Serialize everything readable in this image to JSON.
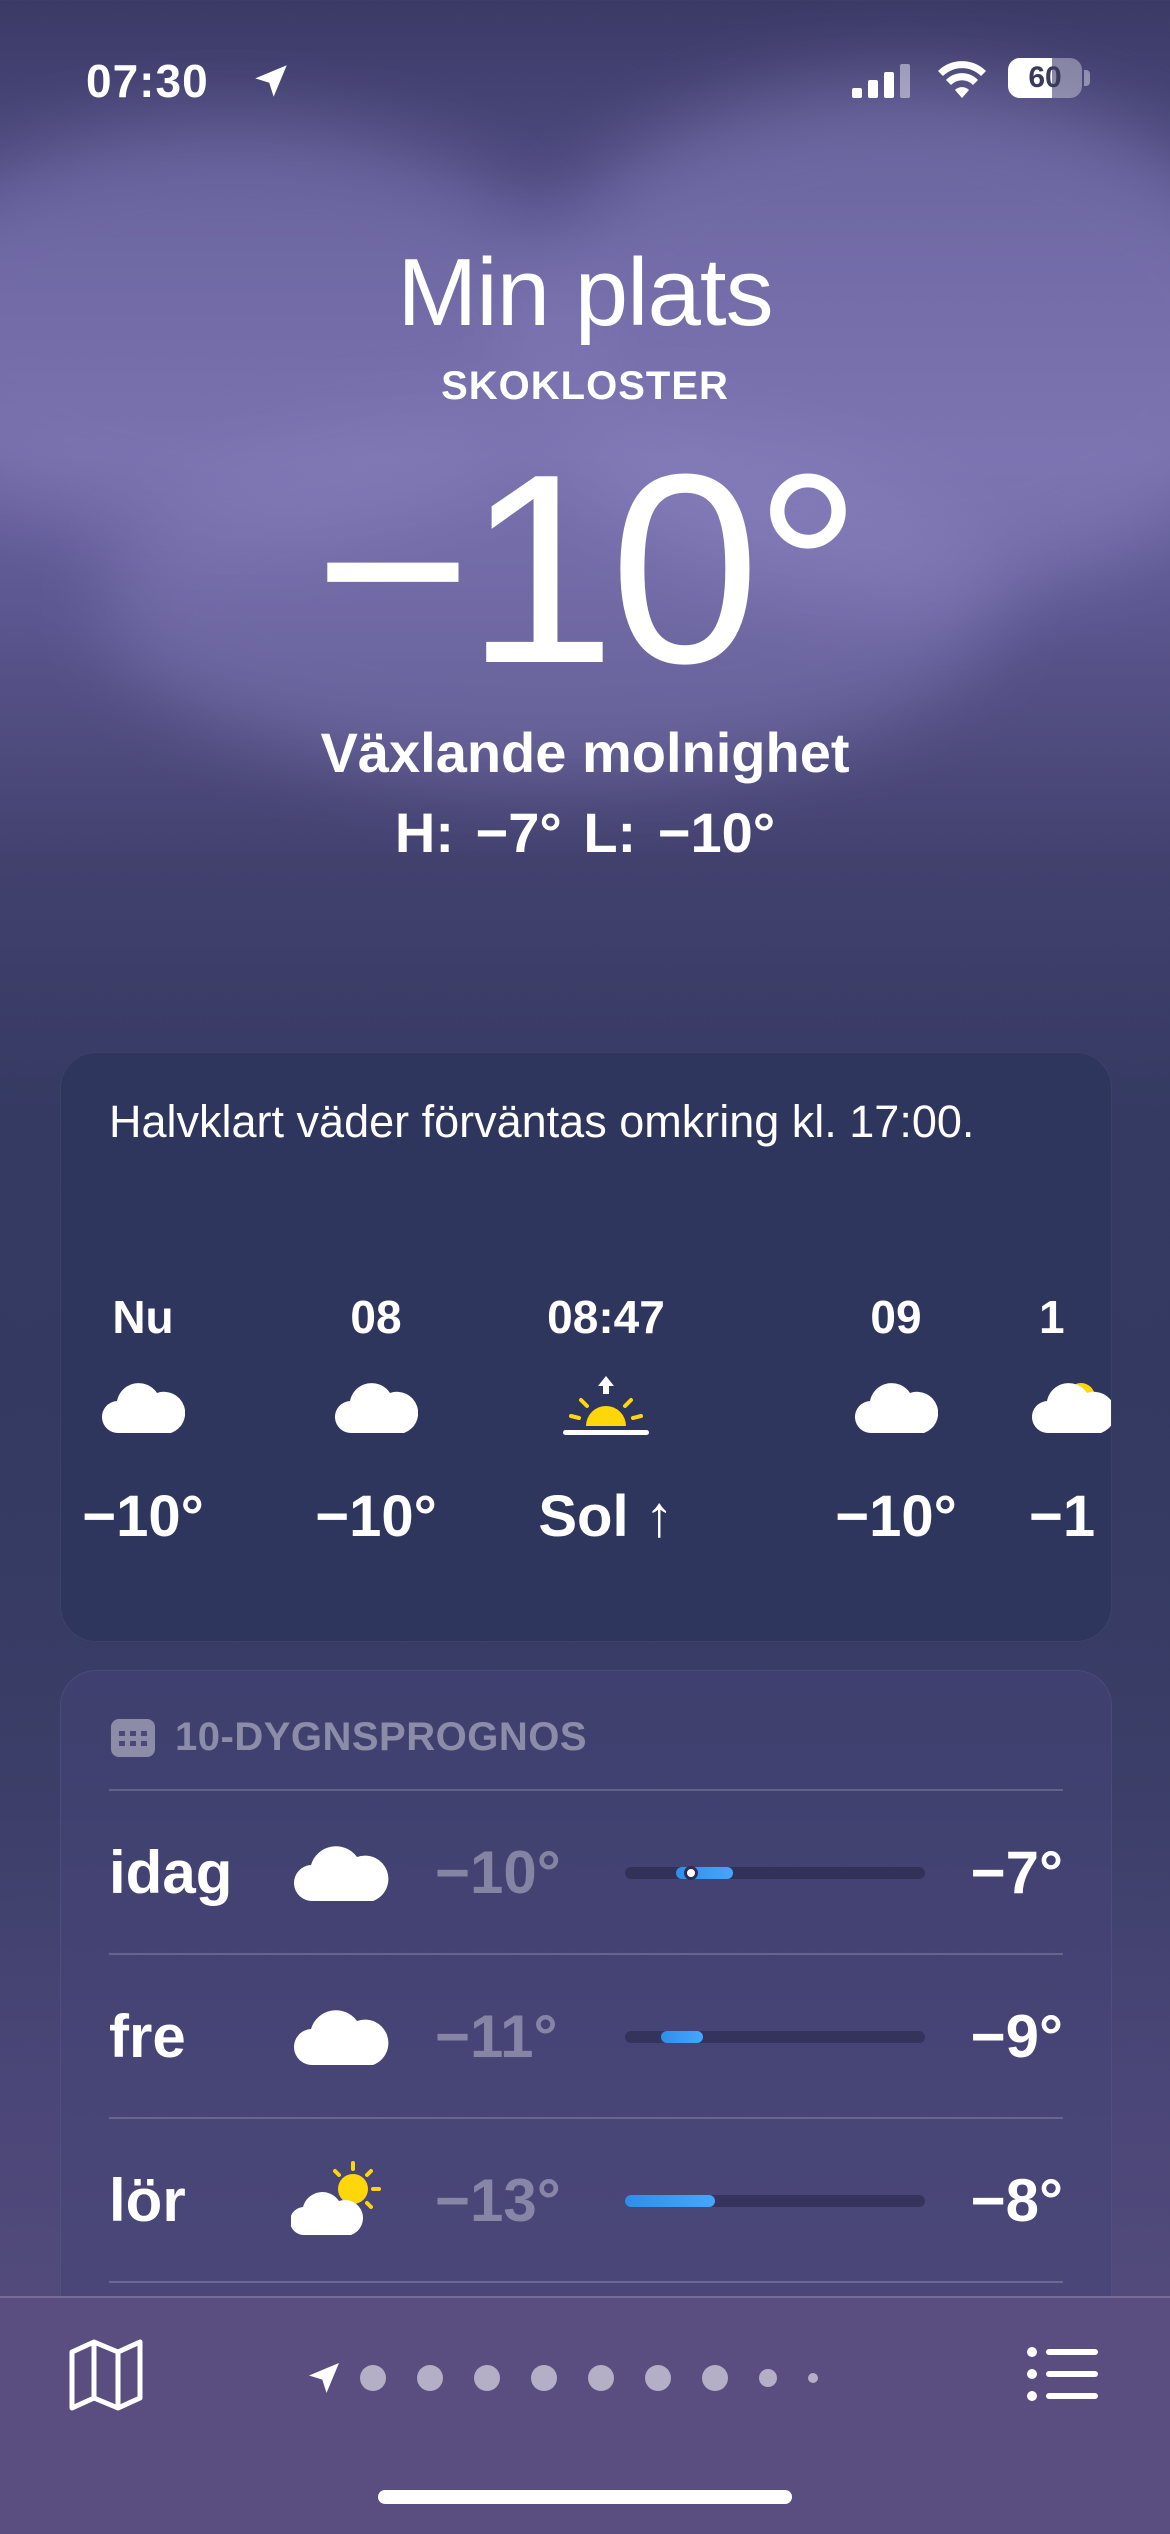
{
  "status_bar": {
    "time": "07:30",
    "battery_percent": 60,
    "battery_label": "60"
  },
  "hero": {
    "title": "Min plats",
    "subtitle": "SKOKLOSTER",
    "temperature": "−10°",
    "condition": "Växlande molnighet",
    "hi_lo": "H: −7°  L: −10°"
  },
  "hourly": {
    "summary": "Halvklart väder förväntas omkring kl. 17:00.",
    "items": [
      {
        "label": "Nu",
        "icon": "cloud-icon",
        "temp": "−10°"
      },
      {
        "label": "08",
        "icon": "cloud-icon",
        "temp": "−10°"
      },
      {
        "label": "08:47",
        "icon": "sunrise-icon",
        "temp": "Sol ↑"
      },
      {
        "label": "09",
        "icon": "cloud-icon",
        "temp": "−10°"
      },
      {
        "label": "1",
        "icon": "cloud-sun-icon",
        "temp": "−1"
      }
    ]
  },
  "daily": {
    "header": "10-DYGNSPROGNOS",
    "header_icon": "calendar-icon",
    "days": [
      {
        "name": "idag",
        "icon": "cloud-icon",
        "low": "−10°",
        "high": "−7°",
        "bar_start": 0.17,
        "bar_end": 0.36,
        "current_marker": 0.22
      },
      {
        "name": "fre",
        "icon": "cloud-icon",
        "low": "−11°",
        "high": "−9°",
        "bar_start": 0.12,
        "bar_end": 0.26
      },
      {
        "name": "lör",
        "icon": "sun-cloud-icon",
        "low": "−13°",
        "high": "−8°",
        "bar_start": 0.0,
        "bar_end": 0.3
      }
    ]
  },
  "bottom_bar": {
    "left_icon": "map-icon",
    "right_icon": "list-icon",
    "page_count": 8,
    "current_page": 0
  },
  "colors": {
    "accent_blue": "#44a6ff",
    "sun_yellow": "#ffd60a",
    "bottom_bar": "#5a4e80"
  }
}
